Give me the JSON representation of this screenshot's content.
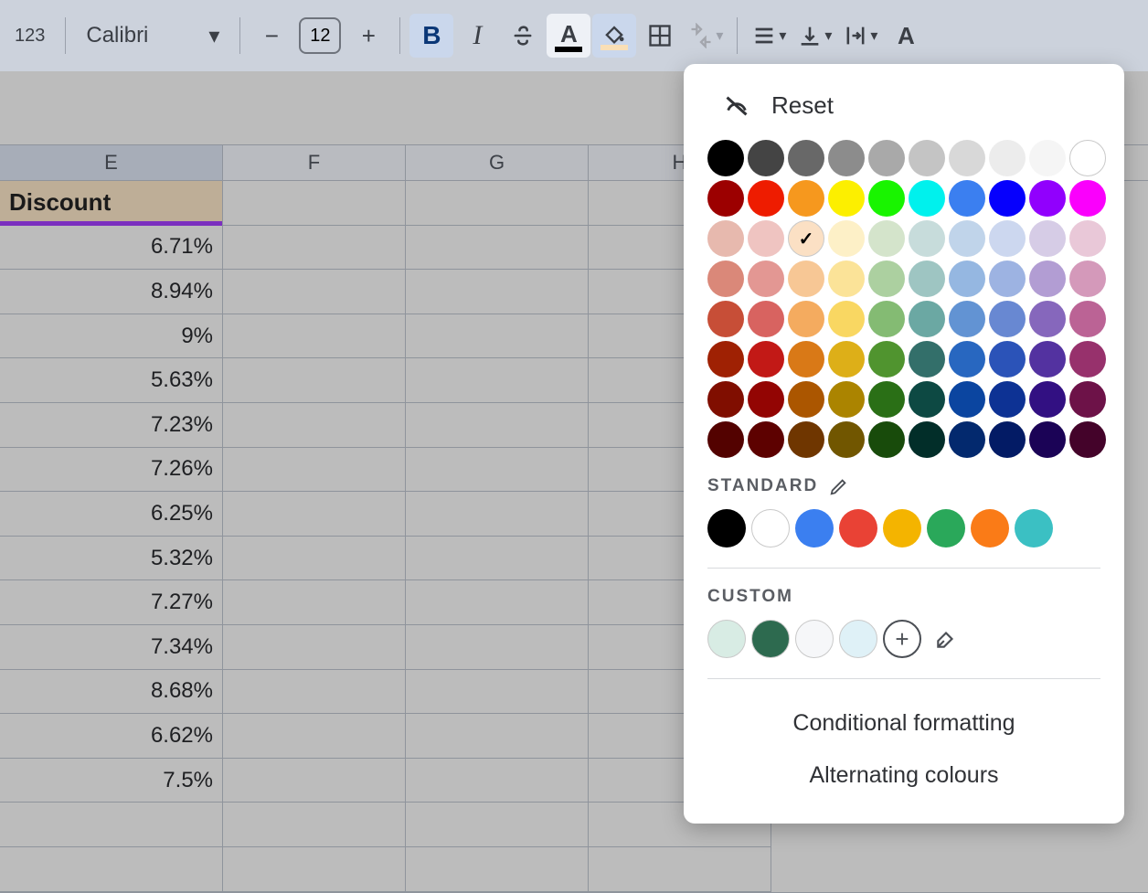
{
  "toolbar": {
    "format_label": "123",
    "font_name": "Calibri",
    "font_size": "12"
  },
  "columns": [
    "E",
    "F",
    "G",
    "H"
  ],
  "header_cell": "Discount",
  "values": [
    "6.71%",
    "8.94%",
    "9%",
    "5.63%",
    "7.23%",
    "7.26%",
    "6.25%",
    "5.32%",
    "7.27%",
    "7.34%",
    "8.68%",
    "6.62%",
    "7.5%"
  ],
  "popup": {
    "reset": "Reset",
    "standard_label": "STANDARD",
    "custom_label": "CUSTOM",
    "conditional": "Conditional formatting",
    "alternating": "Alternating colours",
    "palette": [
      [
        "#000000",
        "#444444",
        "#686868",
        "#8c8c8c",
        "#a9a9a9",
        "#c4c4c4",
        "#d8d8d8",
        "#ececec",
        "#f5f5f5",
        "#ffffff"
      ],
      [
        "#9c0000",
        "#ee1c00",
        "#f6981e",
        "#fcef00",
        "#19f400",
        "#00f1ed",
        "#3b7ff0",
        "#0600fd",
        "#9100fd",
        "#fa00fc"
      ],
      [
        "#e7b9ae",
        "#efc4c1",
        "#fbe0c4",
        "#fdf0c7",
        "#d4e4cb",
        "#c7dcdb",
        "#c0d4ea",
        "#ccd7ef",
        "#d6cce6",
        "#e9c8d8"
      ],
      [
        "#da8879",
        "#e39793",
        "#f7c795",
        "#fbe398",
        "#acd0a0",
        "#9ec5c2",
        "#95b7e1",
        "#9db3e2",
        "#b29dd3",
        "#d499ba"
      ],
      [
        "#c74e37",
        "#d86360",
        "#f4ab5f",
        "#f9d762",
        "#84bb73",
        "#6ba8a3",
        "#6293d3",
        "#6888d2",
        "#8667bc",
        "#bb6395"
      ],
      [
        "#9f2103",
        "#c21916",
        "#d97917",
        "#ddaf18",
        "#50942f",
        "#336f6a",
        "#2867c0",
        "#2b53b8",
        "#5332a0",
        "#97316c"
      ],
      [
        "#800e00",
        "#930503",
        "#ab5600",
        "#ab8400",
        "#2a6f16",
        "#0d4943",
        "#0b45a0",
        "#0d3294",
        "#321082",
        "#6d1248"
      ],
      [
        "#530200",
        "#5d0100",
        "#6f3600",
        "#715600",
        "#184b0b",
        "#022e29",
        "#03296e",
        "#031b65",
        "#1b0356",
        "#44032a"
      ]
    ],
    "selected_row": 2,
    "selected_col": 2,
    "standard_colors": [
      "#000000",
      "#ffffff",
      "#3b7ff0",
      "#e94235",
      "#f4b400",
      "#2aa85a",
      "#fa7b17",
      "#3bc0c3"
    ],
    "custom_colors": [
      "#d8ece4",
      "#2d6a4f",
      "#f6f7f9",
      "#dff1f7"
    ]
  }
}
